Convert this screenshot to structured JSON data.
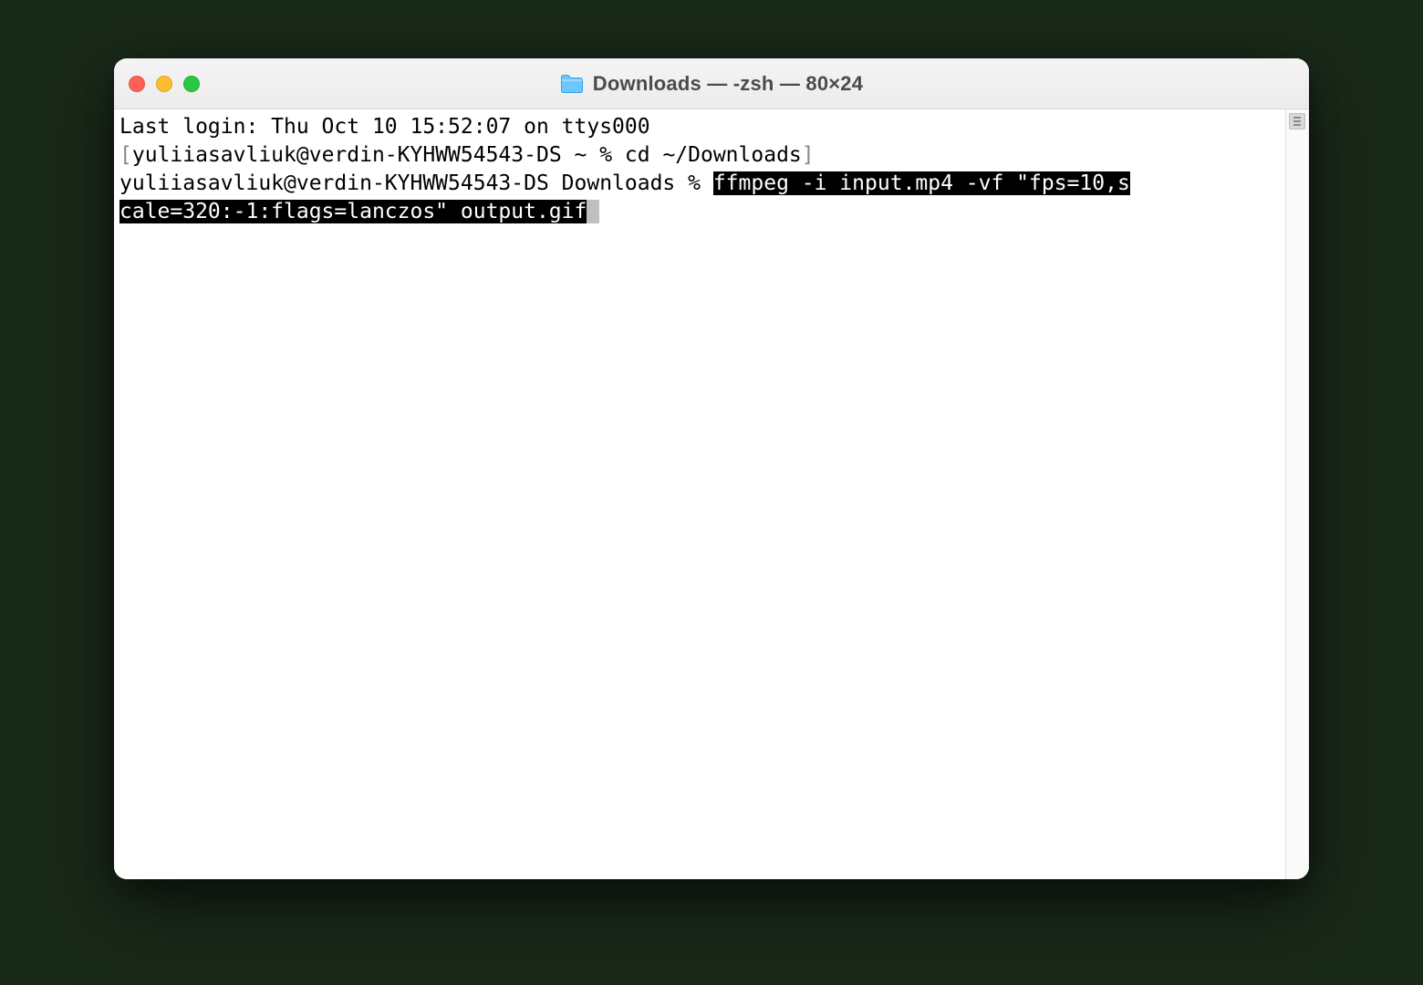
{
  "window": {
    "title": "Downloads — -zsh — 80×24"
  },
  "terminal": {
    "last_login": "Last login: Thu Oct 10 15:52:07 on ttys000",
    "prompt1_open": "[",
    "prompt1_main": "yuliiasavliuk@verdin-KYHWW54543-DS ~ % ",
    "cmd1": "cd ~/Downloads",
    "prompt1_close": "]",
    "prompt2": "yuliiasavliuk@verdin-KYHWW54543-DS Downloads % ",
    "cmd2_selA": "ffmpeg -i input.mp4 -vf \"fps=10,s",
    "cmd2_selB": "cale=320:-1:flags=lanczos\" output.gif",
    "cursor": " "
  }
}
